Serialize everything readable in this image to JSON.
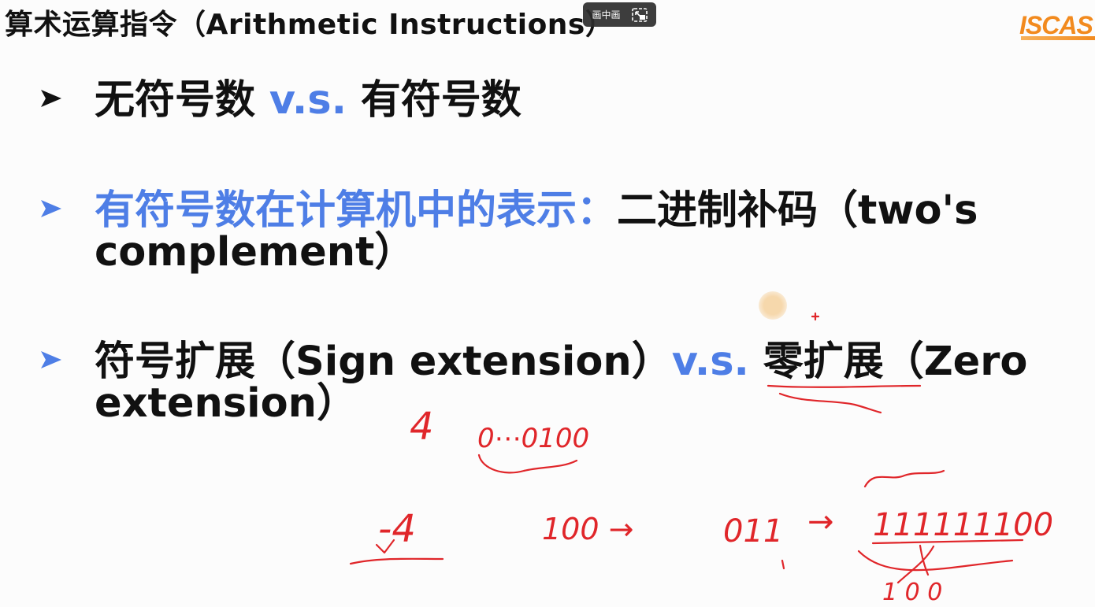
{
  "slide": {
    "title": "算术运算指令（Arithmetic Instructions）",
    "logo_text": "ISCAS",
    "pip_label": "画中画",
    "bullets": [
      {
        "parts": [
          {
            "text": "无符号数 ",
            "color": "black"
          },
          {
            "text": "v.s.",
            "color": "blue"
          },
          {
            "text": " 有符号数",
            "color": "black"
          }
        ]
      },
      {
        "line1": [
          {
            "text": "有符号数在计算机中的表示：",
            "color": "blue"
          },
          {
            "text": "二进制补码（two's",
            "color": "black"
          }
        ],
        "line2": "complement）"
      },
      {
        "line1": [
          {
            "text": " 符号扩展（Sign extension）",
            "color": "black"
          },
          {
            "text": "v.s.",
            "color": "blue"
          },
          {
            "text": " 零扩展（Zero",
            "color": "black"
          }
        ],
        "line2": "extension）"
      }
    ],
    "annotations": {
      "num_pos": "4",
      "bin_pos": "0⋯0100",
      "num_neg": "-4",
      "step1": "100 →",
      "step2": "011",
      "step3": "→",
      "result": "111111100",
      "below_result": "1 0 0"
    }
  },
  "colors": {
    "accent_blue": "#4e7ee6",
    "text_black": "#111111",
    "ink_red": "#e0262a",
    "logo_orange": "#f28a1e"
  }
}
